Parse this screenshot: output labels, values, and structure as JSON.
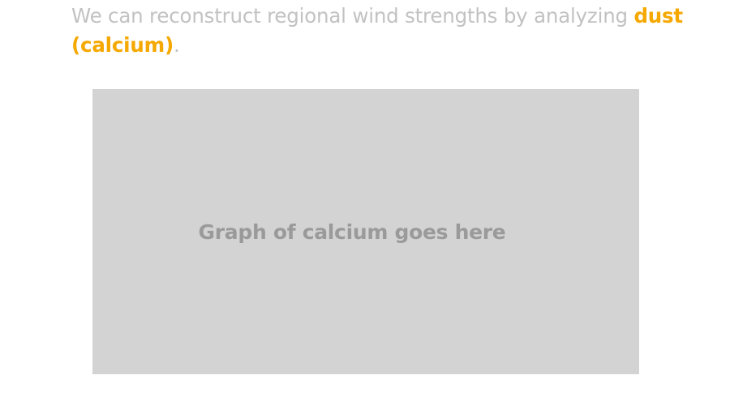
{
  "intro": {
    "text_before": "We can reconstruct regional wind strengths by analyzing ",
    "highlight": "dust (calcium)",
    "text_after": "."
  },
  "graph_placeholder": {
    "label": "Graph of calcium goes here"
  },
  "colors": {
    "intro_text": "#c2c2c2",
    "highlight": "#f5a800",
    "placeholder_bg": "#d3d3d3",
    "placeholder_text": "#9a9a9a"
  }
}
